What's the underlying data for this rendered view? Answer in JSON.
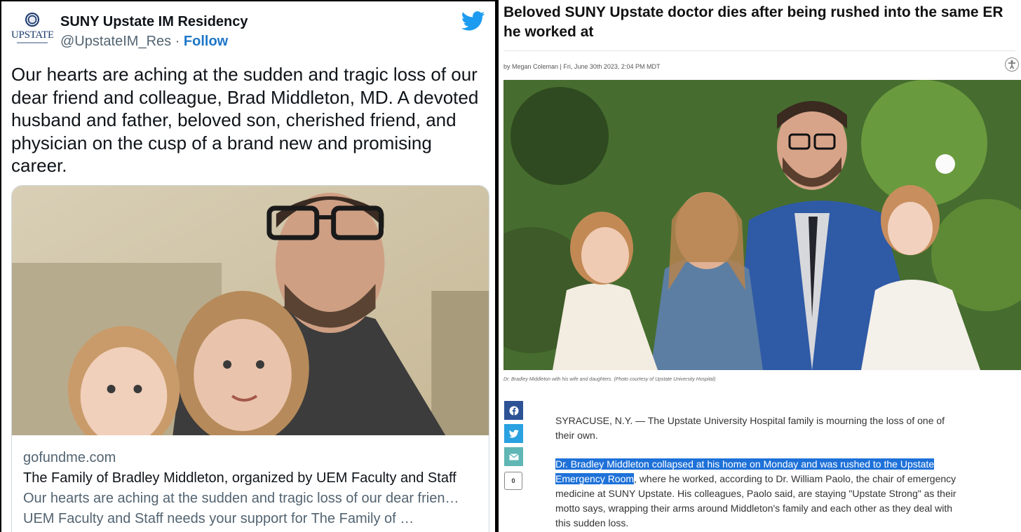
{
  "tweet": {
    "avatar_text": "UPSTATE",
    "display_name": "SUNY Upstate IM Residency",
    "handle": "@UpstateIM_Res",
    "separator": " · ",
    "follow_label": "Follow",
    "icon": "twitter-bird-icon",
    "text": "Our hearts are aching at the sudden and tragic loss of our dear friend and colleague, Brad Middleton, MD. A devoted husband and father, beloved son, cherished friend, and physician on the cusp of a brand new and promising career.",
    "card": {
      "domain": "gofundme.com",
      "title": "The Family of Bradley Middleton, organized by UEM Faculty and Staff",
      "description": "Our hearts are aching at the sudden and tragic loss of our dear frien… UEM Faculty and Staff needs your support for The Family of …"
    },
    "brand_color": "#1d9bf0"
  },
  "article": {
    "headline": "Beloved SUNY Upstate doctor dies after being rushed into the same ER he worked at",
    "byline": "by Megan Coleman | Fri, June 30th 2023, 2:04 PM MDT",
    "caption": "Dr. Bradley Middleton with his wife and daughters. (Photo courtesy of Upstate University Hospital)",
    "share": {
      "facebook_icon": "facebook-icon",
      "twitter_icon": "twitter-icon",
      "email_icon": "email-icon",
      "comment_count": "0"
    },
    "paragraph1": "SYRACUSE, N.Y. — The Upstate University Hospital family is mourning the loss of one of their own.",
    "paragraph2_highlight": "Dr. Bradley Middleton collapsed at his home on Monday and was rushed to the Upstate Emergency Room",
    "paragraph2_rest": ", where he worked, according to Dr. William Paolo, the chair of emergency medicine at SUNY Upstate. His colleagues, Paolo said, are staying \"Upstate Strong\" as their motto says, wrapping their arms around Middleton's family and each other as they deal with this sudden loss.",
    "highlight_color": "#1e71d8"
  }
}
